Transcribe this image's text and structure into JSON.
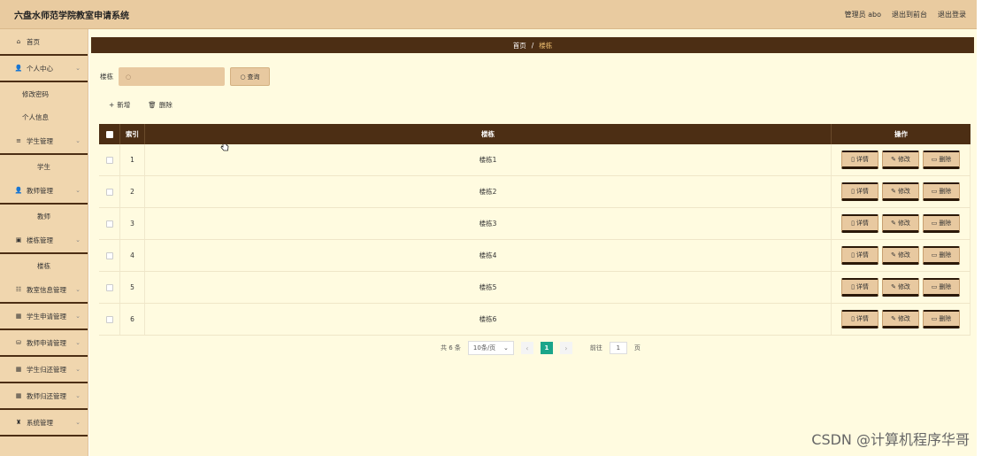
{
  "header": {
    "title": "六盘水师范学院教室申请系统",
    "user": "管理员 abo",
    "to_front": "退出到前台",
    "logout": "退出登录"
  },
  "sidebar": {
    "items": [
      {
        "icon": "home-icon",
        "glyph": "⌂",
        "label": "首页",
        "chevron": false
      },
      {
        "icon": "user-icon",
        "glyph": "👤",
        "label": "个人中心",
        "chevron": true
      },
      {
        "sub": true,
        "label": "修改密码"
      },
      {
        "sub": true,
        "label": "个人信息"
      },
      {
        "icon": "list-icon",
        "glyph": "≡",
        "label": "学生管理",
        "chevron": true
      },
      {
        "sub": true,
        "center": true,
        "label": "学生"
      },
      {
        "icon": "teacher-icon",
        "glyph": "👤",
        "label": "教师管理",
        "chevron": true
      },
      {
        "sub": true,
        "center": true,
        "label": "教师"
      },
      {
        "icon": "building-icon",
        "glyph": "▣",
        "label": "楼栋管理",
        "chevron": true
      },
      {
        "sub": true,
        "center": true,
        "label": "楼栋"
      },
      {
        "icon": "settings-icon",
        "glyph": "☷",
        "label": "教室信息管理",
        "chevron": true
      },
      {
        "icon": "grid-icon",
        "glyph": "▦",
        "label": "学生申请管理",
        "chevron": true
      },
      {
        "icon": "database-icon",
        "glyph": "⛁",
        "label": "教师申请管理",
        "chevron": true
      },
      {
        "icon": "grid-icon",
        "glyph": "▦",
        "label": "学生归还管理",
        "chevron": true
      },
      {
        "icon": "grid-icon",
        "glyph": "▦",
        "label": "教师归还管理",
        "chevron": true
      },
      {
        "icon": "system-icon",
        "glyph": "♜",
        "label": "系统管理",
        "chevron": true
      }
    ]
  },
  "breadcrumb": {
    "home": "首页",
    "sep": "/",
    "current": "楼栋"
  },
  "search": {
    "label": "楼栋",
    "placeholder": "",
    "button": "查询"
  },
  "actions": {
    "add": "新增",
    "delete": "删除"
  },
  "table": {
    "headers": {
      "index": "索引",
      "name": "楼栋",
      "ops": "操作"
    },
    "rows": [
      {
        "index": "1",
        "name": "楼栋1"
      },
      {
        "index": "2",
        "name": "楼栋2"
      },
      {
        "index": "3",
        "name": "楼栋3"
      },
      {
        "index": "4",
        "name": "楼栋4"
      },
      {
        "index": "5",
        "name": "楼栋5"
      },
      {
        "index": "6",
        "name": "楼栋6"
      }
    ],
    "op_labels": {
      "detail": "详情",
      "edit": "修改",
      "delete": "删除"
    }
  },
  "pagination": {
    "total": "共 6 条",
    "page_size": "10条/页",
    "current": "1",
    "goto_label": "前往",
    "goto_value": "1",
    "page_unit": "页"
  },
  "watermark": "CSDN @计算机程序华哥"
}
